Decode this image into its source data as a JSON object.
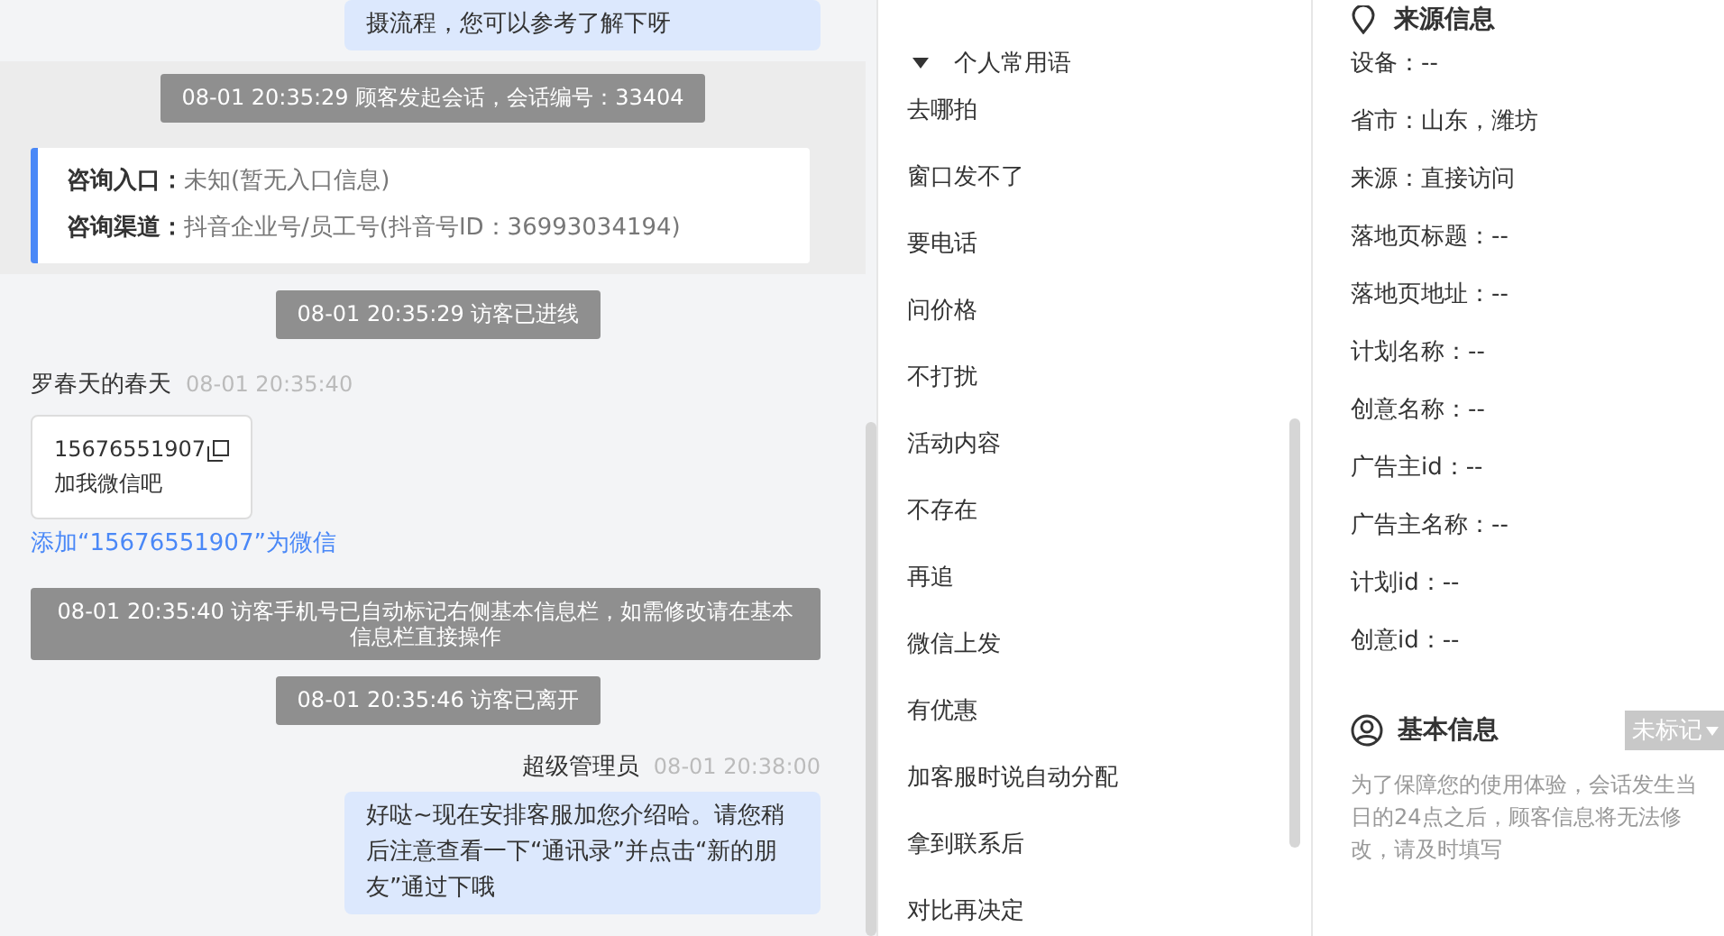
{
  "chat": {
    "messages": [
      {
        "kind": "agent_bubble",
        "text": "摄流程，您可以参考了解下呀"
      },
      {
        "kind": "session_block",
        "notice": "08-01 20:35:29 顾客发起会话，会话编号：33404",
        "entry_label": "咨询入口：",
        "entry_value": "未知(暂无入口信息)",
        "channel_label": "咨询渠道：",
        "channel_value": "抖音企业号/员工号(抖音号ID：36993034194)"
      },
      {
        "kind": "system",
        "text": "08-01 20:35:29 访客已进线"
      },
      {
        "kind": "visitor",
        "name": "罗春天的春天",
        "time": "08-01 20:35:40",
        "card_lines": [
          "15676551907",
          "加我微信吧"
        ],
        "link": "添加“15676551907”为微信"
      },
      {
        "kind": "system_wide",
        "text": "08-01 20:35:40 访客手机号已自动标记右侧基本信息栏，如需修改请在基本信息栏直接操作"
      },
      {
        "kind": "system",
        "text": "08-01 20:35:46 访客已离开"
      },
      {
        "kind": "agent_header",
        "name": "超级管理员",
        "time": "08-01 20:38:00"
      },
      {
        "kind": "agent_bubble",
        "text": "好哒~现在安排客服加您介绍哈。请您稍后注意查看一下“通讯录”并点击“新的朋友”通过下哦"
      }
    ]
  },
  "phrases": {
    "group": {
      "label": "个人常用语",
      "expanded": true
    },
    "items": [
      "去哪拍",
      "窗口发不了",
      "要电话",
      "问价格",
      "不打扰",
      "活动内容",
      "不存在",
      "再追",
      "微信上发",
      "有优惠",
      "加客服时说自动分配",
      "拿到联系后",
      "对比再决定"
    ]
  },
  "source_info": {
    "title": "来源信息",
    "fields": [
      "设备：--",
      "省市：山东，潍坊",
      "来源：直接访问",
      "落地页标题：--",
      "落地页地址：--",
      "计划名称：--",
      "创意名称：--",
      "广告主id：--",
      "广告主名称：--",
      "计划id：--",
      "创意id：--"
    ]
  },
  "basic_info": {
    "title": "基本信息",
    "tag": "未标记",
    "notice": "为了保障您的使用体验，会话发生当日的24点之后，顾客信息将无法修改，请及时填写"
  }
}
